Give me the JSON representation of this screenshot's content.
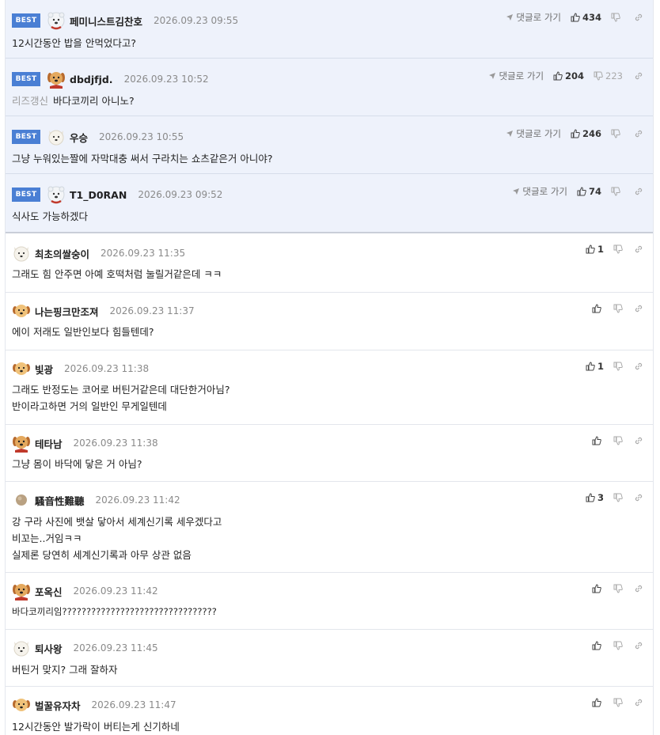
{
  "reply_label": "댓글로 가기",
  "best_label": "BEST",
  "best": [
    {
      "nick": "페미니스트김찬호",
      "time": "2026.09.23 09:55",
      "avatar": "bear",
      "text": [
        "12시간동안 밥을 안먹었다고?"
      ],
      "prefix": "",
      "likes": "434",
      "dislikes": ""
    },
    {
      "nick": "dbdjfjd.",
      "time": "2026.09.23 10:52",
      "avatar": "puppy",
      "text": [
        "바다코끼리 아니노?"
      ],
      "prefix": "리즈갱신",
      "likes": "204",
      "dislikes": "223"
    },
    {
      "nick": "우승",
      "time": "2026.09.23 10:55",
      "avatar": "dog",
      "text": [
        "그냥 누워있는짤에 자막대충 써서 구라치는 쇼츠같은거 아니야?"
      ],
      "prefix": "",
      "likes": "246",
      "dislikes": ""
    },
    {
      "nick": "T1_D0RAN",
      "time": "2026.09.23 09:52",
      "avatar": "bear",
      "text": [
        "식사도 가능하겠다"
      ],
      "prefix": "",
      "likes": "74",
      "dislikes": ""
    }
  ],
  "comments": [
    {
      "nick": "최초의쌀숭이",
      "time": "2026.09.23 11:35",
      "avatar": "dog",
      "text": [
        "그래도 힘 안주면 아예 호떡처럼 눌릴거같은데 ㅋㅋ"
      ],
      "likes": "1"
    },
    {
      "nick": "나는핑크만조져",
      "time": "2026.09.23 11:37",
      "avatar": "puppy-small",
      "text": [
        "에이 저래도 일반인보다 힘들텐데?"
      ],
      "likes": ""
    },
    {
      "nick": "빛광",
      "time": "2026.09.23 11:38",
      "avatar": "puppy-small",
      "text": [
        "그래도 반정도는 코어로 버틴거같은데 대단한거아님?",
        "반이라고하면 거의 일반인 무게일텐데"
      ],
      "likes": "1"
    },
    {
      "nick": "테타남",
      "time": "2026.09.23 11:38",
      "avatar": "puppy",
      "text": [
        "그냥 몸이 바닥에 닿은 거 아님?"
      ],
      "likes": ""
    },
    {
      "nick": "騷音性難聽",
      "time": "2026.09.23 11:42",
      "avatar": "ball",
      "text": [
        "강 구라 사진에 뱃살 닿아서 세계신기록 세우겠다고",
        "비꼬는..거임ㅋㅋ",
        "실제론 당연히 세계신기록과 아무 상관 없음"
      ],
      "likes": "3"
    },
    {
      "nick": "포옥신",
      "time": "2026.09.23 11:42",
      "avatar": "puppy",
      "text": [
        "바다코끼리임????????????????????????????????"
      ],
      "likes": ""
    },
    {
      "nick": "퇴사왕",
      "time": "2026.09.23 11:45",
      "avatar": "dog",
      "text": [
        "버틴거 맞지? 그래 잘하자"
      ],
      "likes": ""
    },
    {
      "nick": "벌꿀유자차",
      "time": "2026.09.23 11:47",
      "avatar": "puppy-small",
      "text": [
        "12시간동안 발가락이 버티는게 신기하네"
      ],
      "likes": ""
    }
  ]
}
